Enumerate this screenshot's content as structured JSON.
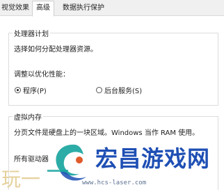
{
  "tabs": [
    {
      "label": "视觉效果"
    },
    {
      "label": "高级"
    },
    {
      "label": "数据执行保护"
    }
  ],
  "processor_group": {
    "title": "处理器计划",
    "description": "选择如何分配处理器资源。",
    "adjust_label": "调整以优化性能：",
    "options": [
      {
        "label": "程序(P)",
        "selected": true
      },
      {
        "label": "后台服务(S)",
        "selected": false
      }
    ]
  },
  "virtual_memory_group": {
    "title": "虚拟内存",
    "description": "分页文件是硬盘上的一块区域。Windows 当作 RAM 使用。",
    "all_drives_label": "所有驱动器"
  },
  "watermark": {
    "left_text": "玩一",
    "brand_text": "宏昌游戏网",
    "url_text": "www.hcs-laser.com",
    "brand_color": "#1e4fb4",
    "logo_icon": "swirl-logo-icon"
  }
}
